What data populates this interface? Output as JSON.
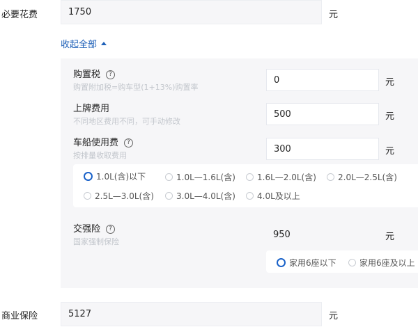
{
  "required_fee": {
    "label": "必要花费",
    "value": "1750",
    "unit": "元"
  },
  "collapse": {
    "label": "收起全部"
  },
  "purchase_tax": {
    "title": "购置税",
    "hint": "购置附加税=购车型(1+13%)购置率",
    "value": "0",
    "unit": "元"
  },
  "plate_fee": {
    "title": "上牌费用",
    "hint": "不同地区费用不同，可手动修改",
    "value": "500",
    "unit": "元"
  },
  "vessel_tax": {
    "title": "车船使用费",
    "hint": "按排量收取费用",
    "value": "300",
    "unit": "元",
    "options": [
      "1.0L(含)以下",
      "1.0L—1.6L(含)",
      "1.6L—2.0L(含)",
      "2.0L—2.5L(含)",
      "2.5L—3.0L(含)",
      "3.0L—4.0L(含)",
      "4.0L及以上"
    ],
    "selected": "1.0L(含)以下"
  },
  "compulsory_insurance": {
    "title": "交强险",
    "hint": "国家强制保险",
    "value": "950",
    "unit": "元",
    "options": [
      "家用6座以下",
      "家用6座及以上"
    ],
    "selected": "家用6座以下"
  },
  "commercial_insurance": {
    "label": "商业保险",
    "value": "5127",
    "unit": "元"
  },
  "icons": {
    "help": "question-circle-icon",
    "collapse": "triangle-up-icon"
  },
  "colors": {
    "accent": "#1e60b8",
    "panel_bg": "#f6f6f8",
    "hint": "#c2c6cc"
  }
}
